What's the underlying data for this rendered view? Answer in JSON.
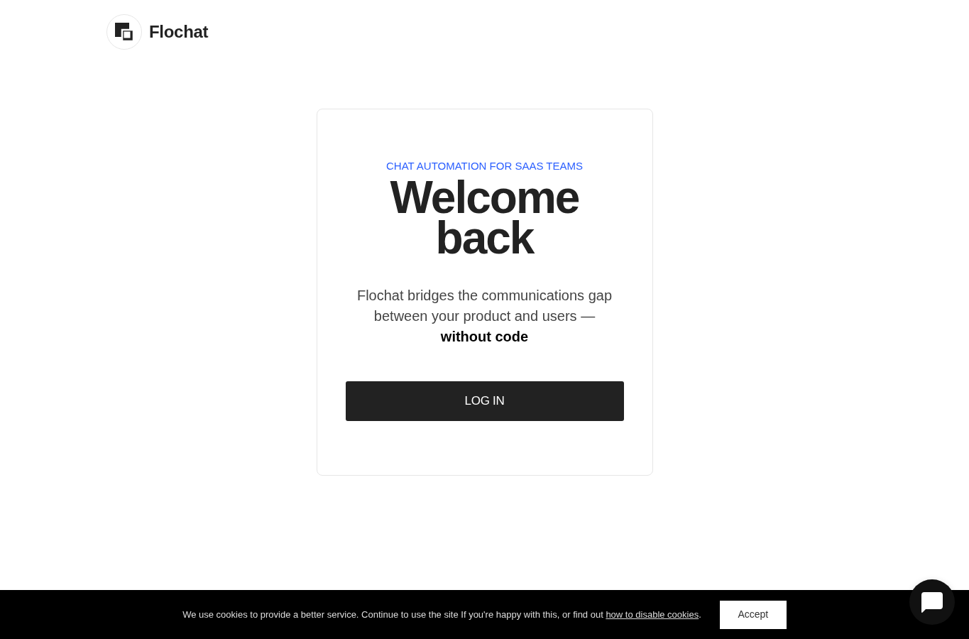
{
  "header": {
    "brand": "Flochat"
  },
  "card": {
    "eyebrow": "CHAT AUTOMATION FOR SAAS TEAMS",
    "title": "Welcome back",
    "description": "Flochat bridges the communications gap between your product and users — **without code**",
    "button": "LOG IN"
  },
  "cookie_banner": {
    "text": "We use cookies to provide a better service. Continue to use the site If you're happy with this, or find out ",
    "link": "how to disable cookies",
    "suffix": ".",
    "button": "Accept"
  }
}
